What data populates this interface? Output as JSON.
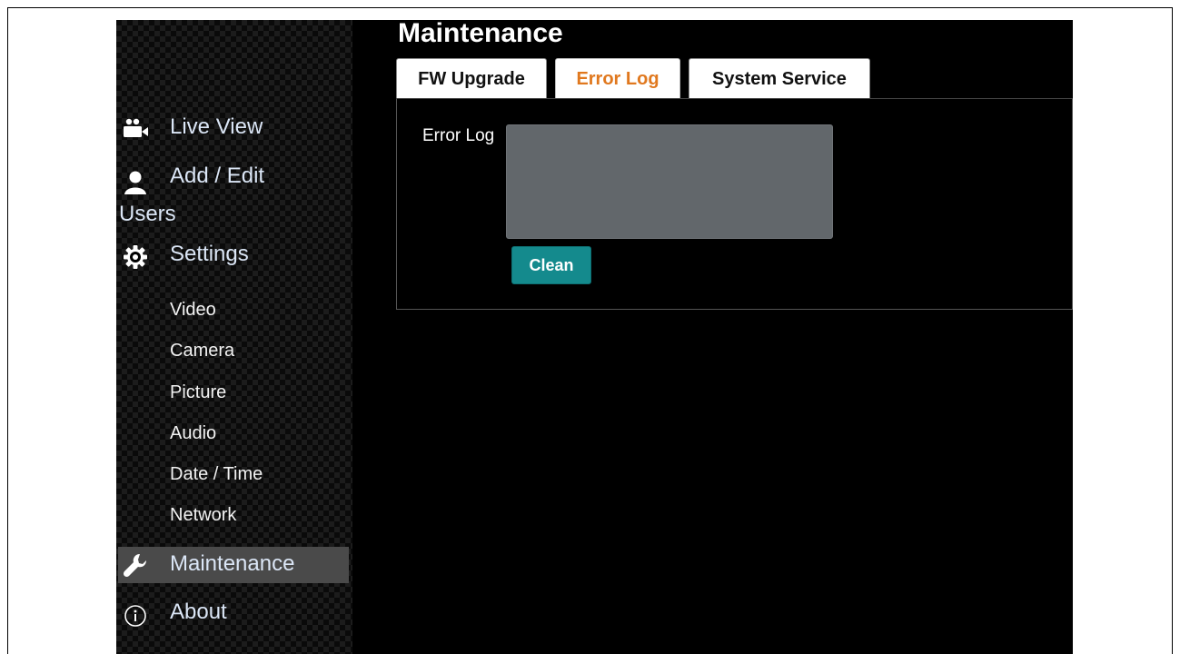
{
  "page": {
    "title": "Maintenance"
  },
  "tabs": [
    {
      "label": "FW Upgrade",
      "active": false
    },
    {
      "label": "Error Log",
      "active": true
    },
    {
      "label": "System Service",
      "active": false
    }
  ],
  "sidebar": {
    "main_items": [
      {
        "label": "Live View",
        "icon": "camera-users-icon"
      },
      {
        "label": "Add / Edit",
        "label_cont": "Users",
        "icon": "user-icon"
      },
      {
        "label": "Settings",
        "icon": "gear-icon"
      },
      {
        "label": "Maintenance",
        "icon": "wrench-icon",
        "active": true
      },
      {
        "label": "About",
        "icon": "info-icon"
      }
    ],
    "settings_items": [
      "Video",
      "Camera",
      "Picture",
      "Audio",
      "Date / Time",
      "Network"
    ]
  },
  "error_log": {
    "field_label": "Error Log",
    "value": "",
    "clean_label": "Clean"
  },
  "colors": {
    "active_tab_text": "#e0781e",
    "button": "#148a8d",
    "log_box": "#62676b",
    "active_nav_bg": "#4a4a4a",
    "nav_text": "#dbe6f6"
  }
}
